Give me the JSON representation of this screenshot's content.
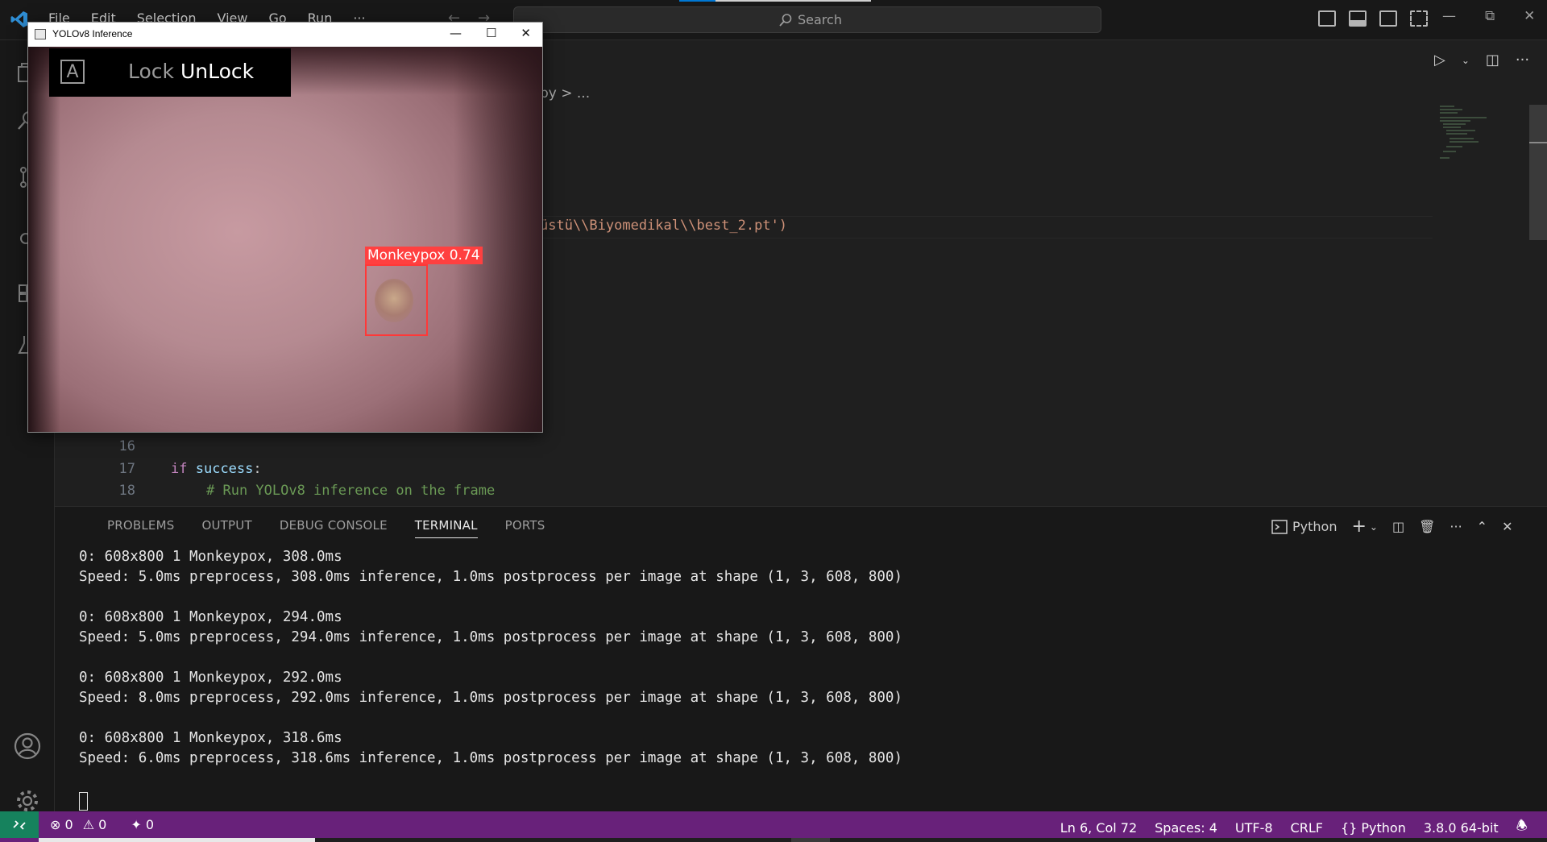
{
  "menu": [
    "File",
    "Edit",
    "Selection",
    "View",
    "Go",
    "Run",
    "···"
  ],
  "search": {
    "label": "Search"
  },
  "breadcrumb": {
    "text": "py > ..."
  },
  "code": {
    "line_14_partial": "üstü\\\\Biyomedikal\\\\best_2.pt')",
    "line_15_partial": ", ...",
    "lines": [
      {
        "num": "16",
        "text": ""
      },
      {
        "num": "17",
        "kw": "if",
        "var": "success",
        "rest": ":"
      },
      {
        "num": "18",
        "comment": "# Run YOLOv8 inference on the frame"
      }
    ]
  },
  "panel": {
    "tabs": [
      "PROBLEMS",
      "OUTPUT",
      "DEBUG CONSOLE",
      "TERMINAL",
      "PORTS"
    ],
    "active_tab": "TERMINAL",
    "terminal_profile": "Python"
  },
  "terminal": [
    "0: 608x800 1 Monkeypox, 308.0ms",
    "Speed: 5.0ms preprocess, 308.0ms inference, 1.0ms postprocess per image at shape (1, 3, 608, 800)",
    "",
    "0: 608x800 1 Monkeypox, 294.0ms",
    "Speed: 5.0ms preprocess, 294.0ms inference, 1.0ms postprocess per image at shape (1, 3, 608, 800)",
    "",
    "0: 608x800 1 Monkeypox, 292.0ms",
    "Speed: 8.0ms preprocess, 292.0ms inference, 1.0ms postprocess per image at shape (1, 3, 608, 800)",
    "",
    "0: 608x800 1 Monkeypox, 318.6ms",
    "Speed: 6.0ms preprocess, 318.6ms inference, 1.0ms postprocess per image at shape (1, 3, 608, 800)"
  ],
  "statusbar": {
    "errors": "0",
    "warnings": "0",
    "ports": "0",
    "position": "Ln 6, Col 72",
    "spaces": "Spaces: 4",
    "encoding": "UTF-8",
    "eol": "CRLF",
    "language": "Python",
    "interpreter": "3.8.0 64-bit"
  },
  "yolo_window": {
    "title": "YOLOv8 Inference",
    "lock_key": "A",
    "lock": "Lock",
    "unlock": "UnLock",
    "detection_label": "Monkeypox 0.74"
  },
  "colors": {
    "statusbar": "#68217a",
    "remote": "#16825d",
    "detection": "#ff4040",
    "string": "#ce9178",
    "comment": "#6a9955",
    "keyword": "#c586c0"
  }
}
